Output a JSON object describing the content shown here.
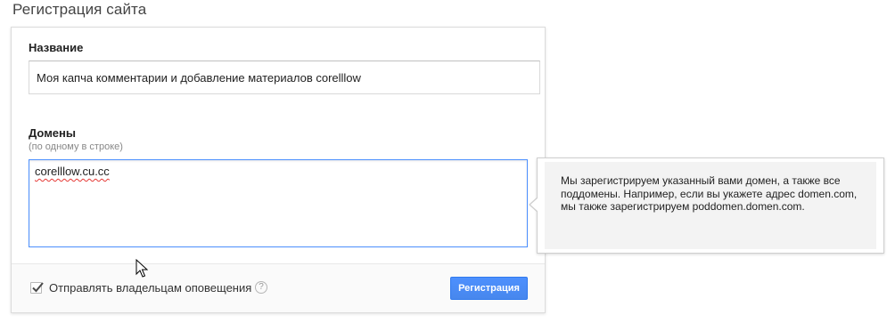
{
  "page": {
    "title": "Регистрация сайта"
  },
  "form": {
    "name_label": "Название",
    "name_value": "Моя капча комментарии и добавление материалов corelllow",
    "domains_label": "Домены",
    "domains_hint": "(по одному в строке)",
    "domains_value": "corelllow.cu.cc",
    "notify_label": "Отправлять владельцам оповещения",
    "notify_checked": true,
    "help_icon_glyph": "?",
    "submit_label": "Регистрация"
  },
  "tooltip": {
    "text": "Мы зарегистрируем указанный вами домен, а также все поддомены. Например, если вы укажете адрес domen.com, мы также зарегистрируем poddomen.domen.com."
  },
  "icons": {
    "checkbox": "checkmark-icon",
    "help": "question-circle-icon",
    "cursor": "mouse-pointer-icon"
  },
  "colors": {
    "accent": "#4d90fe",
    "button_border": "#3079ed",
    "spellcheck": "#e53935"
  }
}
